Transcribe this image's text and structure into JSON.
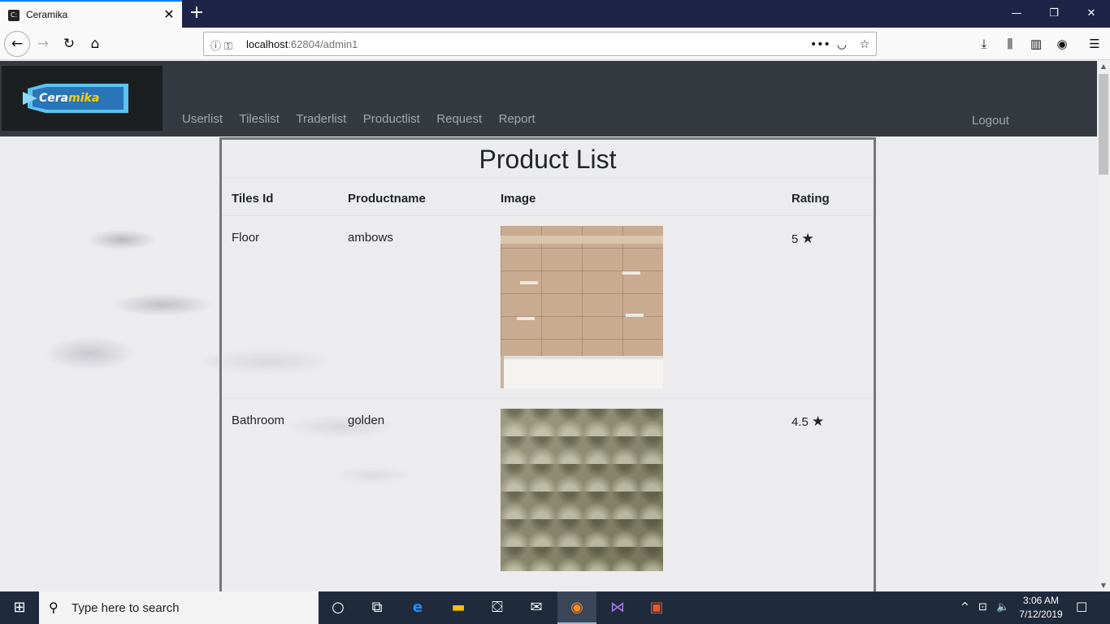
{
  "browser": {
    "tab_title": "Ceramika",
    "tab_favicon": "C:",
    "url_host": "localhost",
    "url_rest": ":62804/admin1",
    "icons": {
      "close": "✕",
      "newtab": "+",
      "back": "←",
      "forward": "→",
      "reload": "↻",
      "home": "⌂",
      "info": "ⓘ",
      "key": "⚿",
      "more": "•••",
      "pocket": "◡",
      "bookmark": "☆",
      "download": "⤓",
      "library": "⫼",
      "sidebar": "▥",
      "account": "◉",
      "menu": "☰",
      "minimize": "—",
      "restore": "❐",
      "win_close": "✕"
    }
  },
  "site": {
    "logo_text_a": "Cera",
    "logo_text_b": "mika",
    "nav": [
      "Userlist",
      "Tileslist",
      "Traderlist",
      "Productlist",
      "Request",
      "Report"
    ],
    "logout": "Logout"
  },
  "product_list": {
    "title": "Product List",
    "columns": [
      "Tiles Id",
      "Productname",
      "Image",
      "Rating"
    ],
    "rows": [
      {
        "tiles_id": "Floor",
        "productname": "ambows",
        "image": "bathroom-tile-photo",
        "rating": "5",
        "star": "★"
      },
      {
        "tiles_id": "Bathroom",
        "productname": "golden",
        "image": "golden-shell-tile-photo",
        "rating": "4.5",
        "star": "★"
      }
    ]
  },
  "taskbar": {
    "search_placeholder": "Type here to search",
    "time": "3:06 AM",
    "date": "7/12/2019",
    "icons": {
      "start": "⊞",
      "search": "⚲",
      "cortana": "○",
      "taskview": "⧉",
      "edge": "e",
      "explorer": "▬",
      "store": "⛋",
      "mail": "✉",
      "firefox": "◉",
      "vs": "⋈",
      "office": "▣",
      "chevron": "^",
      "network": "⊡",
      "volume": "🔈",
      "notify": "☐"
    }
  },
  "colors": {
    "header_bg": "#343a40",
    "taskbar_bg": "#1f2a3c",
    "tab_accent": "#0a84ff",
    "logo_accent": "#f5d000"
  }
}
